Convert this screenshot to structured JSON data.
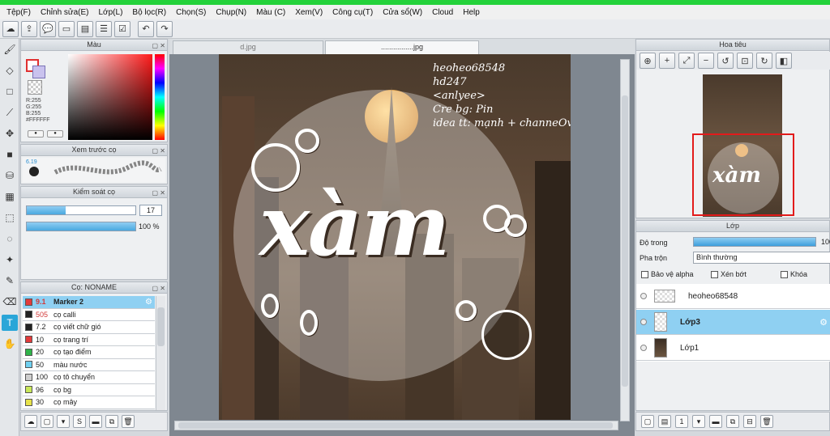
{
  "menu": [
    "Tệp(F)",
    "Chỉnh sửa(E)",
    "Lớp(L)",
    "Bộ lọc(R)",
    "Chọn(S)",
    "Chụp(N)",
    "Màu (C)",
    "Xem(V)",
    "Công cụ(T)",
    "Cửa sổ(W)",
    "Cloud",
    "Help"
  ],
  "panels": {
    "color": {
      "title": "Màu",
      "r": "R:255",
      "g": "G:255",
      "b": "B:255",
      "hex": "#FFFFFF"
    },
    "preview": {
      "title": "Xem trước cọ",
      "size": "6.19"
    },
    "control": {
      "title": "Kiểm soát cọ",
      "size_value": "17",
      "opacity_value": "100 %",
      "size_fraction": 0.36,
      "opacity_fraction": 1.0
    },
    "brush": {
      "title": "Cọ: NONAME",
      "items": [
        {
          "size": "9.1",
          "name": "Marker 2",
          "color": "#e23b3b",
          "selected": true
        },
        {
          "size": "505",
          "name": "cọ calli",
          "color": "#222222",
          "selected": false
        },
        {
          "size": "7.2",
          "name": "cọ viết chữ gió",
          "color": "#222222",
          "selected": false
        },
        {
          "size": "10",
          "name": "cọ trang trí",
          "color": "#e23b3b",
          "selected": false
        },
        {
          "size": "20",
          "name": "cọ tạo điểm",
          "color": "#2fb34a",
          "selected": false
        },
        {
          "size": "50",
          "name": "màu nước",
          "color": "#6fd0f0",
          "selected": false
        },
        {
          "size": "100",
          "name": "cọ tô chuyển",
          "color": "#cfcfcf",
          "selected": false
        },
        {
          "size": "96",
          "name": "cọ bg",
          "color": "#c9e85a",
          "selected": false
        },
        {
          "size": "30",
          "name": "cọ mây",
          "color": "#e6e24a",
          "selected": false
        }
      ]
    },
    "navigator": {
      "title": "Hoa tiêu"
    },
    "layer": {
      "title": "Lớp",
      "opacity_label": "Độ trong",
      "opacity_value": "100",
      "blend_label": "Pha trộn",
      "blend_value": "Bình thường",
      "protect_alpha": "Bảo vệ alpha",
      "clipping": "Xén bớt",
      "lock": "Khóa",
      "layers": [
        {
          "name": "heoheo68548",
          "thumb": "transparent",
          "selected": false
        },
        {
          "name": "Lớp3",
          "thumb": "transparent",
          "selected": true
        },
        {
          "name": "Lớp1",
          "thumb": "image",
          "selected": false
        }
      ]
    }
  },
  "tabs": [
    {
      "label": "d.jpg",
      "active": false
    },
    {
      "label": "................jpg",
      "active": true
    }
  ],
  "artwork": {
    "credits": [
      "heoheo68548",
      "hd247",
      "<anlyee>",
      "Cre bg: Pin",
      "idea tt: mạnh + channeOvO"
    ],
    "title_word": "xàm"
  },
  "icons": {
    "toolbar": [
      "cloud-icon",
      "export-icon",
      "speech-icon",
      "screen-icon",
      "page-icon",
      "list-icon",
      "check-list-icon",
      "undo-icon",
      "redo-icon"
    ],
    "left_tools": [
      "brush-icon",
      "eraser-icon",
      "rect-select-icon",
      "line-icon",
      "move-icon",
      "fill-rect-icon",
      "bucket-icon",
      "gradient-icon",
      "marquee-icon",
      "lasso-icon",
      "magic-wand-icon",
      "select-pen-icon",
      "select-eraser-icon",
      "text-icon",
      "hand-icon"
    ]
  }
}
